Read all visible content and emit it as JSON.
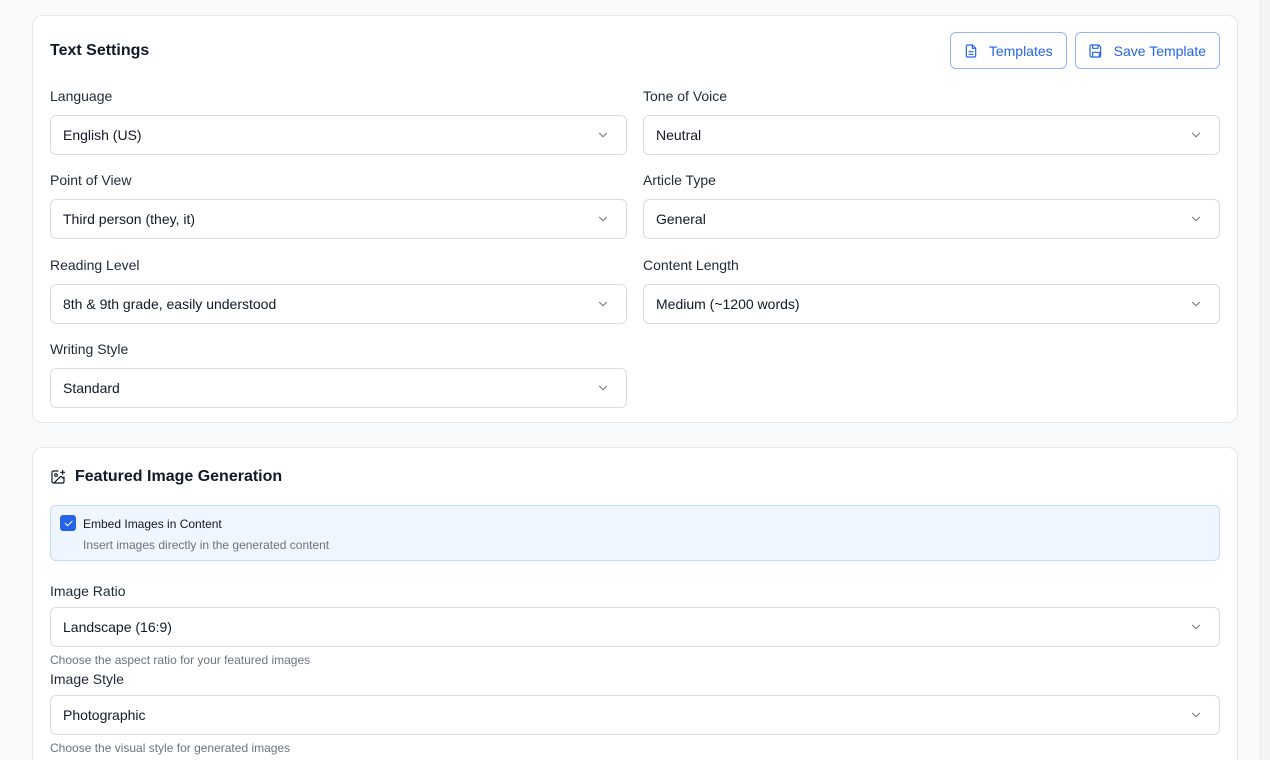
{
  "text_settings": {
    "title": "Text Settings",
    "templates_label": "Templates",
    "save_template_label": "Save Template",
    "language": {
      "label": "Language",
      "value": "English (US)"
    },
    "tone": {
      "label": "Tone of Voice",
      "value": "Neutral"
    },
    "point_of_view": {
      "label": "Point of View",
      "value": "Third person (they, it)"
    },
    "article_type": {
      "label": "Article Type",
      "value": "General"
    },
    "reading_level": {
      "label": "Reading Level",
      "value": "8th & 9th grade, easily understood"
    },
    "content_length": {
      "label": "Content Length",
      "value": "Medium (~1200 words)"
    },
    "writing_style": {
      "label": "Writing Style",
      "value": "Standard"
    }
  },
  "image_generation": {
    "title": "Featured Image Generation",
    "embed": {
      "title": "Embed Images in Content",
      "description": "Insert images directly in the generated content",
      "checked": true
    },
    "ratio": {
      "label": "Image Ratio",
      "value": "Landscape (16:9)",
      "hint": "Choose the aspect ratio for your featured images"
    },
    "style": {
      "label": "Image Style",
      "value": "Photographic",
      "hint": "Choose the visual style for generated images"
    }
  },
  "icons": {
    "templates": "document-icon",
    "save": "save-icon",
    "featured": "image-plus-icon",
    "dropdown": "chevron-down-icon",
    "check": "check-icon"
  },
  "colors": {
    "accent": "#2563eb",
    "embed_bg": "#eff6ff",
    "border": "#e5e7eb"
  }
}
